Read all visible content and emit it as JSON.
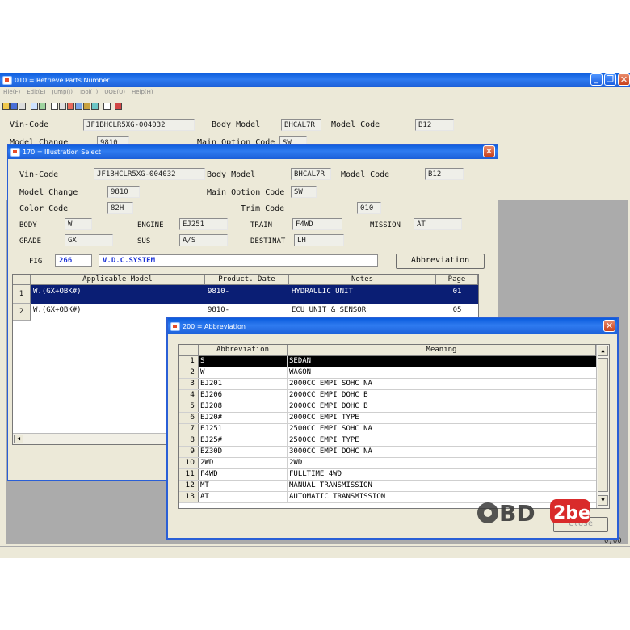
{
  "main_window": {
    "title": "010 = Retrieve Parts Number",
    "menu": [
      "File(F)",
      "Edit(E)",
      "Jump(J)",
      "Tool(T)",
      "UOE(U)",
      "Help(H)"
    ],
    "vin_label": "Vin-Code",
    "vin": "JF1BHCLR5XG-004032",
    "body_model_label": "Body Model",
    "body_model": "BHCAL7R",
    "model_code_label": "Model Code",
    "model_code": "B12",
    "model_change_label": "Model Change",
    "model_change": "9810",
    "main_option_label": "Main Option Code",
    "main_option": "SW",
    "status_value": "0,00"
  },
  "illustration": {
    "title": "170 = Illustration Select",
    "vin_label": "Vin-Code",
    "vin": "JF1BHCLR5XG-004032",
    "body_model_label": "Body Model",
    "body_model": "BHCAL7R",
    "model_code_label": "Model Code",
    "model_code": "B12",
    "model_change_label": "Model Change",
    "model_change": "9810",
    "main_option_label": "Main Option Code",
    "main_option": "SW",
    "color_code_label": "Color Code",
    "color_code": "82H",
    "trim_code_label": "Trim Code",
    "trim_code": "010",
    "body_label": "BODY",
    "body": "W",
    "engine_label": "ENGINE",
    "engine": "EJ251",
    "train_label": "TRAIN",
    "train": "F4WD",
    "mission_label": "MISSION",
    "mission": "AT",
    "grade_label": "GRADE",
    "grade": "GX",
    "sus_label": "SUS",
    "sus": "A/S",
    "destinat_label": "DESTINAT",
    "destinat": "LH",
    "fig_label": "FIG",
    "fig": "266",
    "fig_name": "V.D.C.SYSTEM",
    "abbreviation_button": "Abbreviation",
    "columns": [
      "Applicable Model",
      "Product. Date",
      "Notes",
      "Page"
    ],
    "rows": [
      {
        "n": "1",
        "model": "W.(GX+OBK#)",
        "date": "9810-",
        "notes": "HYDRAULIC UNIT",
        "page": "01"
      },
      {
        "n": "2",
        "model": "W.(GX+OBK#)",
        "date": "9810-",
        "notes": "ECU UNIT & SENSOR",
        "page": "05"
      }
    ]
  },
  "abbreviation": {
    "title": "200 = Abbreviation",
    "columns": [
      "Abbreviation",
      "Meaning"
    ],
    "rows": [
      {
        "n": "1",
        "a": "S",
        "m": "SEDAN"
      },
      {
        "n": "2",
        "a": "W",
        "m": "WAGON"
      },
      {
        "n": "3",
        "a": "EJ201",
        "m": "2000CC EMPI SOHC NA"
      },
      {
        "n": "4",
        "a": "EJ206",
        "m": "2000CC EMPI DOHC B"
      },
      {
        "n": "5",
        "a": "EJ208",
        "m": "2000CC EMPI DOHC B"
      },
      {
        "n": "6",
        "a": "EJ20#",
        "m": "2000CC EMPI TYPE"
      },
      {
        "n": "7",
        "a": "EJ251",
        "m": "2500CC EMPI SOHC NA"
      },
      {
        "n": "8",
        "a": "EJ25#",
        "m": "2500CC EMPI TYPE"
      },
      {
        "n": "9",
        "a": "EZ30D",
        "m": "3000CC EMPI DOHC NA"
      },
      {
        "n": "10",
        "a": "2WD",
        "m": "2WD"
      },
      {
        "n": "11",
        "a": "F4WD",
        "m": "FULLTIME 4WD"
      },
      {
        "n": "12",
        "a": "MT",
        "m": "MANUAL TRANSMISSION"
      },
      {
        "n": "13",
        "a": "AT",
        "m": "AUTOMATIC TRANSMISSION"
      }
    ],
    "close_button": "Close"
  },
  "watermark": "OBD2be"
}
